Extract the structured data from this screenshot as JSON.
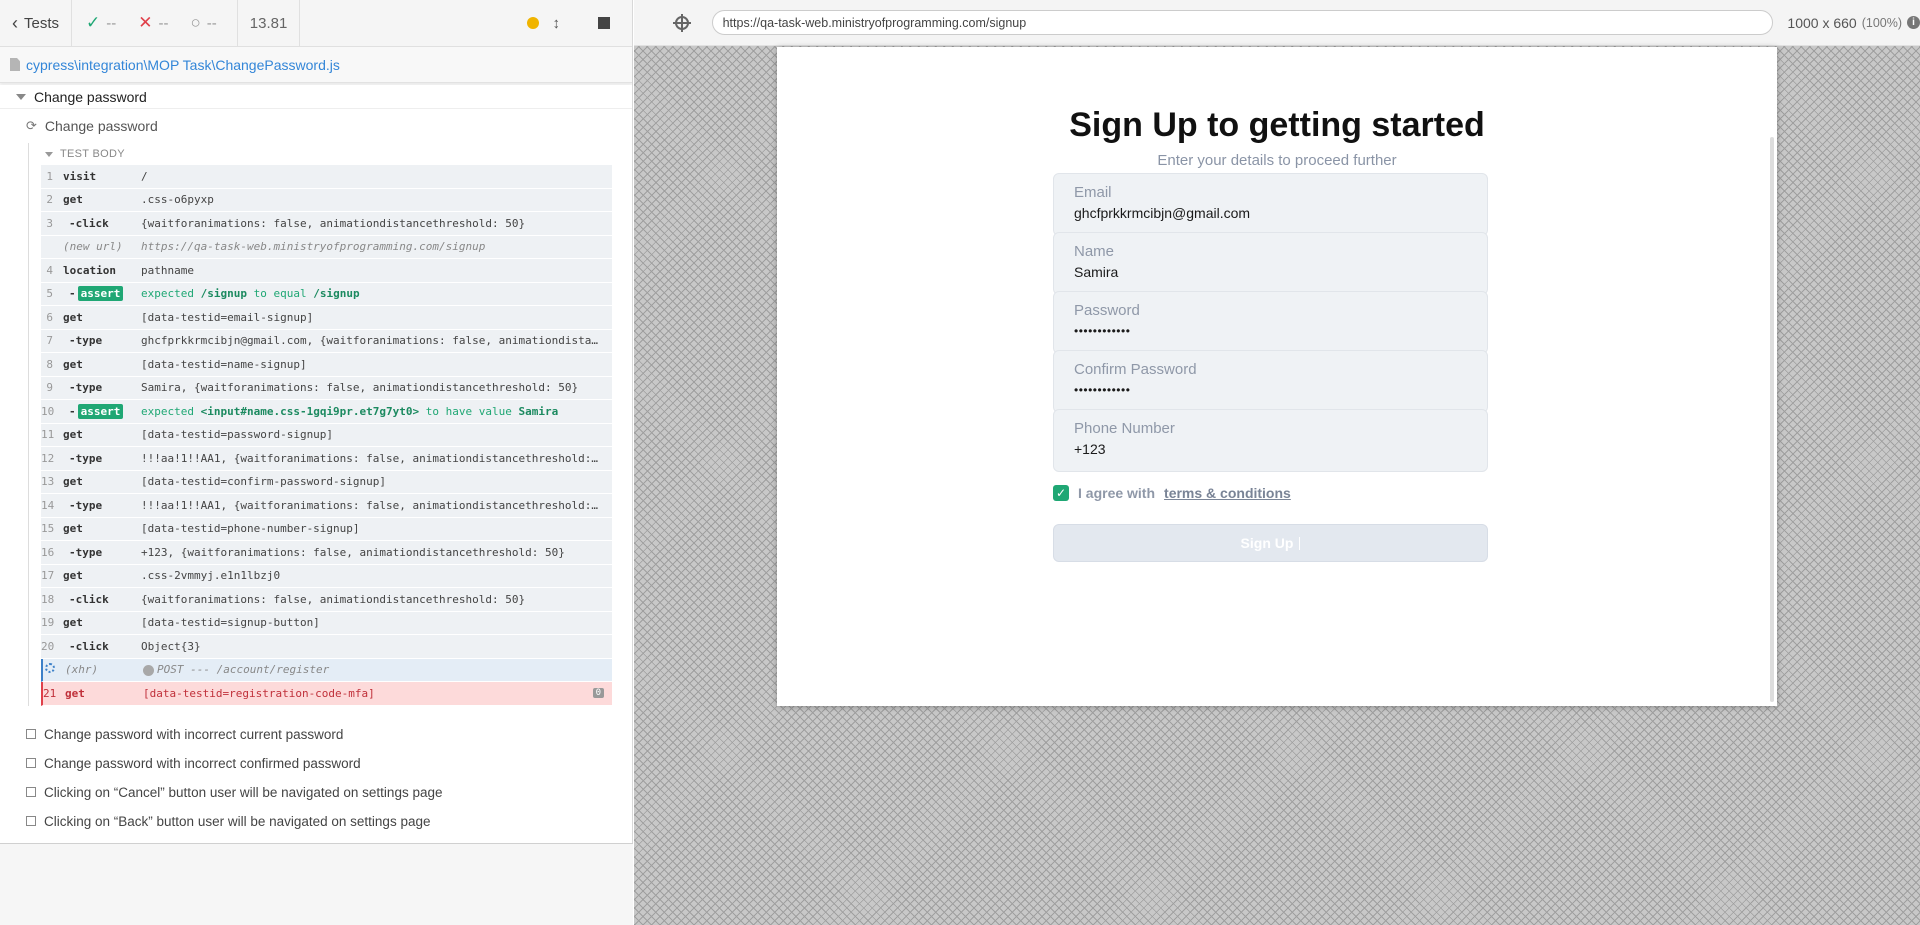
{
  "reporter": {
    "back_label": "Tests",
    "stats": {
      "passed": "--",
      "failed": "--",
      "pending": "--"
    },
    "duration": "13.81",
    "spec_path": "cypress\\integration\\MOP Task\\ChangePassword.js",
    "suite_title": "Change password",
    "active_test": "Change password",
    "test_body_label": "TEST BODY",
    "commands": [
      {
        "num": "1",
        "name": "visit",
        "msg": "/",
        "kind": "normal"
      },
      {
        "num": "2",
        "name": "get",
        "msg": ".css-o6pyxp",
        "kind": "normal"
      },
      {
        "num": "3",
        "name": "-click",
        "msg": "{waitforanimations: false, animationdistancethreshold: 50}",
        "kind": "child"
      },
      {
        "num": "",
        "name": "(new url)",
        "msg": "https://qa-task-web.ministryofprogramming.com/signup",
        "kind": "event"
      },
      {
        "num": "4",
        "name": "location",
        "msg": "pathname",
        "kind": "normal"
      },
      {
        "num": "5",
        "name": "-",
        "badge": "assert",
        "msg_pre": "expected",
        "msg_a": "/signup",
        "msg_mid": "to equal",
        "msg_b": "/signup",
        "kind": "assert"
      },
      {
        "num": "6",
        "name": "get",
        "msg": "[data-testid=email-signup]",
        "kind": "normal"
      },
      {
        "num": "7",
        "name": "-type",
        "msg": "ghcfprkkrmcibjn@gmail.com, {waitforanimations: false, animationdista…",
        "kind": "child"
      },
      {
        "num": "8",
        "name": "get",
        "msg": "[data-testid=name-signup]",
        "kind": "normal"
      },
      {
        "num": "9",
        "name": "-type",
        "msg": "Samira, {waitforanimations: false, animationdistancethreshold: 50}",
        "kind": "child"
      },
      {
        "num": "10",
        "name": "-",
        "badge": "assert",
        "msg_pre": "expected",
        "msg_a": "<input#name.css-1gqi9pr.et7g7yt0>",
        "msg_mid": "to have value",
        "msg_b": "Samira",
        "kind": "assert"
      },
      {
        "num": "11",
        "name": "get",
        "msg": "[data-testid=password-signup]",
        "kind": "normal"
      },
      {
        "num": "12",
        "name": "-type",
        "msg": "!!!aa!1!!AA1, {waitforanimations: false, animationdistancethreshold:…",
        "kind": "child"
      },
      {
        "num": "13",
        "name": "get",
        "msg": "[data-testid=confirm-password-signup]",
        "kind": "normal"
      },
      {
        "num": "14",
        "name": "-type",
        "msg": "!!!aa!1!!AA1, {waitforanimations: false, animationdistancethreshold:…",
        "kind": "child"
      },
      {
        "num": "15",
        "name": "get",
        "msg": "[data-testid=phone-number-signup]",
        "kind": "normal"
      },
      {
        "num": "16",
        "name": "-type",
        "msg": "+123, {waitforanimations: false, animationdistancethreshold: 50}",
        "kind": "child"
      },
      {
        "num": "17",
        "name": "get",
        "msg": ".css-2vmmyj.e1n1lbzj0",
        "kind": "normal"
      },
      {
        "num": "18",
        "name": "-click",
        "msg": "{waitforanimations: false, animationdistancethreshold: 50}",
        "kind": "child"
      },
      {
        "num": "19",
        "name": "get",
        "msg": "[data-testid=signup-button]",
        "kind": "normal"
      },
      {
        "num": "20",
        "name": "-click",
        "msg": "Object{3}",
        "kind": "child"
      },
      {
        "num": "",
        "name": "(xhr)",
        "msg": "POST --- /account/register",
        "kind": "xhr"
      },
      {
        "num": "21",
        "name": "get",
        "msg": "[data-testid=registration-code-mfa]",
        "kind": "failed",
        "count": "0"
      }
    ],
    "other_tests": [
      "Change password with incorrect current password",
      "Change password with incorrect confirmed password",
      "Clicking on “Cancel” button user will be navigated on settings page",
      "Clicking on “Back” button user will be navigated on settings page"
    ]
  },
  "aut": {
    "url": "https://qa-task-web.ministryofprogramming.com/signup",
    "viewport": "1000 x 660",
    "zoom": "(100%)",
    "info_icon": "i"
  },
  "signup": {
    "title": "Sign Up to getting started",
    "subtitle": "Enter your details to proceed further",
    "fields": [
      {
        "label": "Email",
        "value": "ghcfprkkrmcibjn@gmail.com"
      },
      {
        "label": "Name",
        "value": "Samira"
      },
      {
        "label": "Password",
        "value": "••••••••••••"
      },
      {
        "label": "Confirm Password",
        "value": "••••••••••••"
      },
      {
        "label": "Phone Number",
        "value": "+123"
      }
    ],
    "agree_text": "I agree with",
    "agree_link": "terms & conditions",
    "button_label": "Sign Up"
  },
  "colors": {
    "pass": "#1fa774",
    "fail": "#e0404a",
    "link": "#3386d8",
    "xhr": "#3c80c8"
  }
}
